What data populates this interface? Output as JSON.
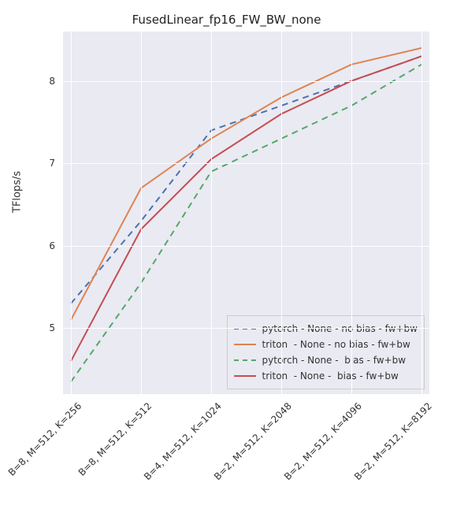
{
  "chart_data": {
    "type": "line",
    "title": "FusedLinear_fp16_FW_BW_none",
    "ylabel": "TFlops/s",
    "xlabel": "",
    "categories": [
      "B=8, M=512, K=256",
      "B=8, M=512, K=512",
      "B=4, M=512, K=1024",
      "B=2, M=512, K=2048",
      "B=2, M=512, K=4096",
      "B=2, M=512, K=8192"
    ],
    "ylim": [
      4.2,
      8.6
    ],
    "yticks": [
      5,
      6,
      7,
      8
    ],
    "series": [
      {
        "name": "pytorch - None - no bias - fw+bw",
        "values": [
          5.3,
          6.3,
          7.4,
          7.7,
          8.0,
          8.3
        ],
        "color": "#4c72b0",
        "dash": "8,6"
      },
      {
        "name": "triton  - None - no bias - fw+bw",
        "values": [
          5.1,
          6.7,
          7.3,
          7.8,
          8.2,
          8.4
        ],
        "color": "#dd8452",
        "dash": "none"
      },
      {
        "name": "pytorch - None -  bias - fw+bw",
        "values": [
          4.35,
          5.55,
          6.9,
          7.3,
          7.7,
          8.2
        ],
        "color": "#55a868",
        "dash": "8,6"
      },
      {
        "name": "triton  - None -  bias - fw+bw",
        "values": [
          4.6,
          6.2,
          7.05,
          7.6,
          8.0,
          8.3
        ],
        "color": "#c44e52",
        "dash": "none"
      }
    ],
    "legend_position": "lower right"
  }
}
